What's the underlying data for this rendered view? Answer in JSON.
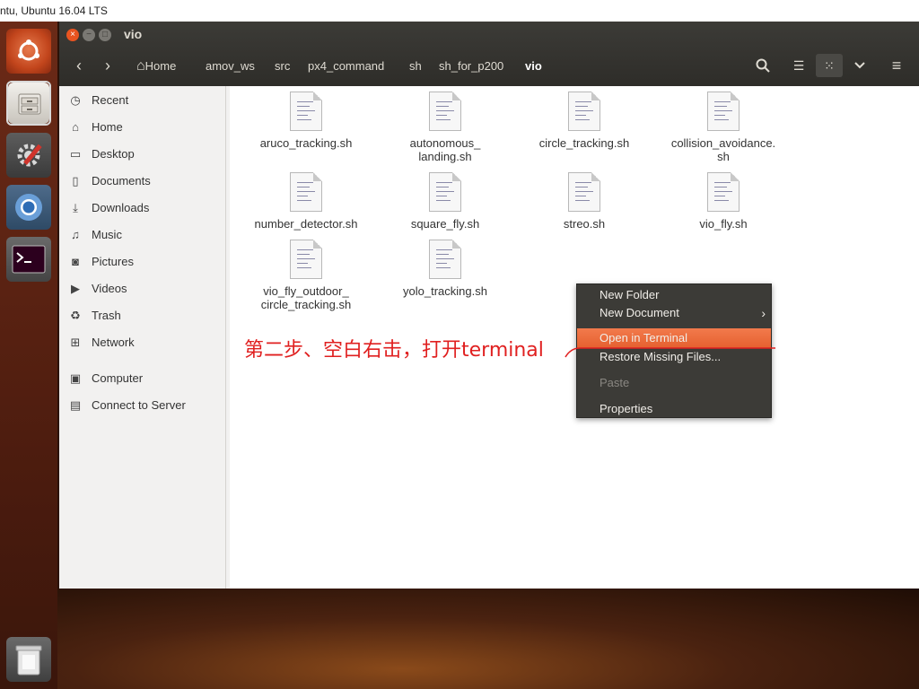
{
  "os_title": "ntu, Ubuntu 16.04 LTS",
  "window": {
    "title": "vio",
    "close_glyph": "×",
    "minimize_glyph": "−",
    "maximize_glyph": "□"
  },
  "nav": {
    "back_glyph": "‹",
    "forward_glyph": "›",
    "home_glyph": "⌂"
  },
  "breadcrumbs": [
    "Home",
    "amov_ws",
    "src",
    "px4_command",
    "sh",
    "sh_for_p200",
    "vio"
  ],
  "toolbar": {
    "search_glyph": "⌕",
    "list_view_glyph": "☰",
    "grid_view_glyph": "⁙",
    "dropdown_glyph": "⌄",
    "menu_glyph": "≡"
  },
  "sidebar": {
    "items": [
      {
        "label": "Recent",
        "icon": "clock-icon",
        "glyph": "◷"
      },
      {
        "label": "Home",
        "icon": "home-icon",
        "glyph": "⌂"
      },
      {
        "label": "Desktop",
        "icon": "desktop-icon",
        "glyph": "▭"
      },
      {
        "label": "Documents",
        "icon": "document-icon",
        "glyph": "▯"
      },
      {
        "label": "Downloads",
        "icon": "download-icon",
        "glyph": "⤓"
      },
      {
        "label": "Music",
        "icon": "music-icon",
        "glyph": "♫"
      },
      {
        "label": "Pictures",
        "icon": "camera-icon",
        "glyph": "◙"
      },
      {
        "label": "Videos",
        "icon": "video-icon",
        "glyph": "▶"
      },
      {
        "label": "Trash",
        "icon": "trash-icon",
        "glyph": "♻"
      },
      {
        "label": "Network",
        "icon": "network-icon",
        "glyph": "⊞"
      },
      {
        "label": "Computer",
        "icon": "computer-icon",
        "glyph": "▣"
      },
      {
        "label": "Connect to Server",
        "icon": "server-icon",
        "glyph": "▤"
      }
    ]
  },
  "files": [
    {
      "name": "aruco_tracking.sh"
    },
    {
      "name": "autonomous_\nlanding.sh"
    },
    {
      "name": "circle_tracking.sh"
    },
    {
      "name": "collision_avoidance.\nsh"
    },
    {
      "name": "number_detector.sh"
    },
    {
      "name": "square_fly.sh"
    },
    {
      "name": "streo.sh"
    },
    {
      "name": "vio_fly.sh"
    },
    {
      "name": "vio_fly_outdoor_\ncircle_tracking.sh"
    },
    {
      "name": "yolo_tracking.sh"
    }
  ],
  "context_menu": {
    "items": [
      {
        "label": "New Folder",
        "state": "normal"
      },
      {
        "label": "New Document",
        "state": "submenu",
        "arrow": "›"
      },
      {
        "label": "Open in Terminal",
        "state": "highlighted"
      },
      {
        "label": "Restore Missing Files...",
        "state": "normal"
      },
      {
        "label": "Paste",
        "state": "disabled"
      },
      {
        "label": "Properties",
        "state": "normal"
      }
    ]
  },
  "annotation": {
    "text": "第二步、空白右击，打开terminal",
    "color": "#e02020"
  },
  "colors": {
    "accent": "#e95420",
    "header": "#3c3b37",
    "launcher": "#5a2212"
  }
}
